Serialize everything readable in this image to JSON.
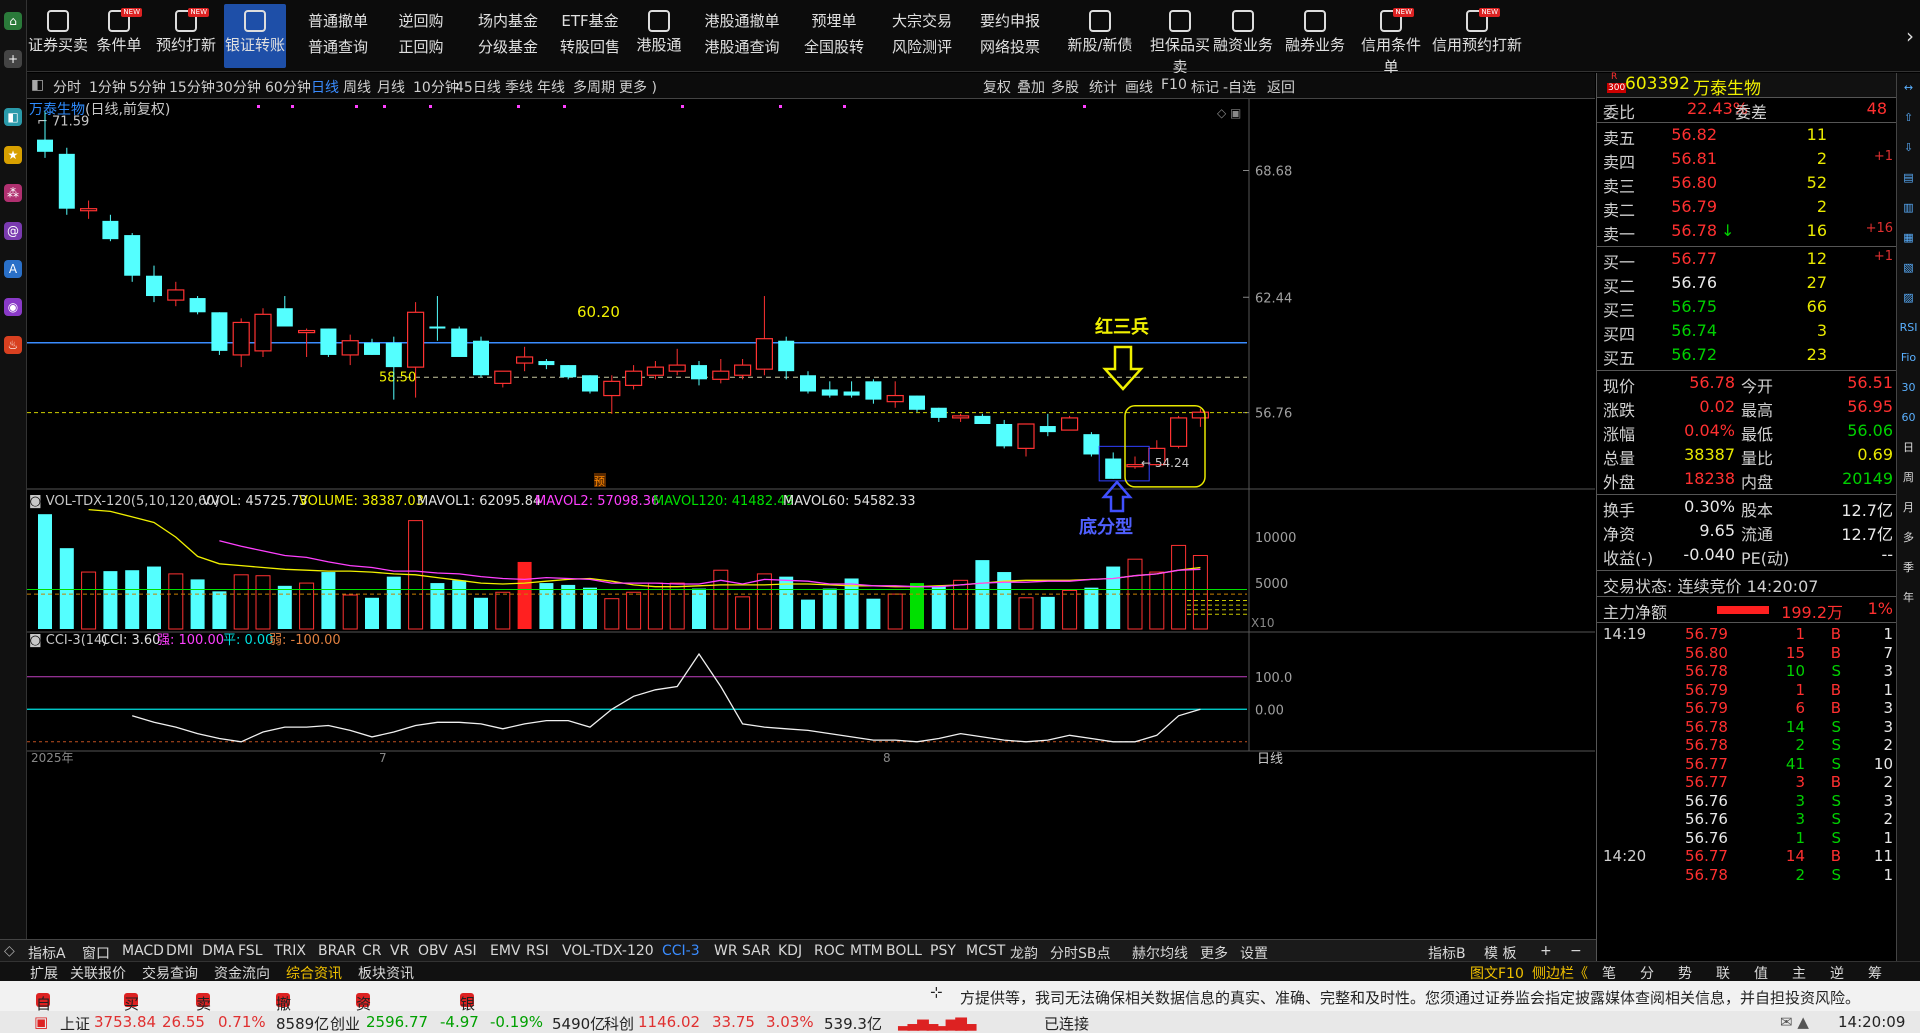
{
  "toolbar": {
    "items": [
      {
        "label": "证券买卖",
        "icon": "chart-up-icon"
      },
      {
        "label": "条件单",
        "icon": "condition-order-icon",
        "badge": "NEW"
      },
      {
        "label": "预约打新",
        "icon": "reserve-ipo-icon",
        "badge": "NEW"
      },
      {
        "label": "银证转账",
        "icon": "bank-transfer-icon",
        "active": true
      },
      {
        "label": "普通撤单",
        "label2": "普通查询"
      },
      {
        "label": "逆回购",
        "label2": "正回购"
      },
      {
        "label": "场内基金",
        "label2": "分级基金"
      },
      {
        "label": "ETF基金",
        "label2": "转股回售"
      },
      {
        "label": "港股通",
        "icon": "hk-icon"
      },
      {
        "label": "港股通撤单",
        "label2": "港股通查询"
      },
      {
        "label": "预埋单",
        "label2": "全国股转"
      },
      {
        "label": "大宗交易",
        "label2": "风险测评"
      },
      {
        "label": "要约申报",
        "label2": "网络投票"
      },
      {
        "label": "新股/新债",
        "icon": "new-stock-icon"
      },
      {
        "label": "担保品买卖",
        "icon": "collateral-icon"
      },
      {
        "label": "融资业务",
        "icon": "margin-finance-icon"
      },
      {
        "label": "融券业务",
        "icon": "short-selling-icon"
      },
      {
        "label": "信用条件单",
        "icon": "credit-condition-icon",
        "badge": "NEW"
      },
      {
        "label": "信用预约打新",
        "icon": "credit-ipo-icon",
        "badge": "NEW"
      }
    ]
  },
  "periods": [
    "分时",
    "1分钟",
    "5分钟",
    "15分钟",
    "30分钟",
    "60分钟",
    "日线",
    "周线",
    "月线",
    "10分钟",
    "45日线",
    "季线",
    "年线",
    "多周期",
    "更多 )"
  ],
  "period_selected": "日线",
  "period_right": [
    "复权",
    "叠加",
    "多股",
    "统计",
    "画线",
    "F10",
    "标记",
    "-自选",
    "返回"
  ],
  "main_chart": {
    "title": "万泰生物",
    "subtitle": "(日线,前复权)",
    "high_label": "71.59",
    "price_labels": [
      "68.68",
      "62.44",
      "56.76"
    ],
    "annot_6020": "60.20",
    "annot_5850": "58.50",
    "annot_5424": "54.24",
    "pre_mark": "预",
    "red_soldiers": "红三兵",
    "bottom_fractal": "底分型",
    "year_label": "2025年",
    "month7": "7",
    "month8": "8",
    "period_name": "日线"
  },
  "chart_data": {
    "type": "candlestick",
    "candles": [
      [
        70.2,
        71.59,
        69.3,
        69.6
      ],
      [
        69.5,
        69.8,
        66.5,
        66.8
      ],
      [
        66.7,
        67.2,
        66.3,
        66.8
      ],
      [
        66.2,
        66.5,
        65.2,
        65.3
      ],
      [
        65.5,
        65.6,
        63.2,
        63.5
      ],
      [
        63.5,
        64.0,
        62.2,
        62.5
      ],
      [
        62.3,
        63.2,
        62.0,
        62.8
      ],
      [
        62.4,
        62.5,
        61.6,
        61.7
      ],
      [
        61.7,
        61.7,
        59.6,
        59.8
      ],
      [
        59.6,
        61.4,
        59.0,
        61.2
      ],
      [
        59.8,
        61.9,
        59.5,
        61.6
      ],
      [
        61.9,
        62.5,
        61.0,
        61.0
      ],
      [
        60.7,
        60.9,
        59.5,
        60.8
      ],
      [
        60.9,
        60.9,
        59.5,
        59.6
      ],
      [
        59.6,
        60.6,
        59.1,
        60.3
      ],
      [
        60.2,
        60.4,
        59.6,
        59.6
      ],
      [
        60.2,
        60.5,
        57.4,
        59.0
      ],
      [
        59.0,
        62.2,
        57.5,
        61.7
      ],
      [
        61.0,
        62.5,
        60.3,
        60.9
      ],
      [
        60.9,
        61.0,
        59.5,
        59.5
      ],
      [
        60.3,
        60.5,
        58.5,
        58.6
      ],
      [
        58.2,
        58.8,
        58.0,
        58.8
      ],
      [
        59.2,
        60.0,
        58.8,
        59.5
      ],
      [
        59.3,
        59.4,
        58.9,
        59.1
      ],
      [
        59.1,
        59.1,
        58.4,
        58.5
      ],
      [
        58.6,
        58.6,
        57.7,
        57.8
      ],
      [
        57.6,
        58.6,
        56.7,
        58.3
      ],
      [
        58.1,
        59.1,
        57.9,
        58.8
      ],
      [
        58.6,
        59.3,
        58.4,
        59.0
      ],
      [
        58.8,
        59.9,
        58.6,
        59.1
      ],
      [
        59.1,
        59.3,
        58.1,
        58.4
      ],
      [
        58.4,
        59.4,
        58.2,
        58.8
      ],
      [
        58.6,
        59.4,
        58.4,
        59.1
      ],
      [
        58.9,
        62.5,
        58.6,
        60.4
      ],
      [
        60.3,
        60.5,
        58.4,
        58.8
      ],
      [
        58.6,
        58.8,
        57.7,
        57.8
      ],
      [
        57.9,
        58.3,
        57.5,
        57.6
      ],
      [
        57.8,
        58.3,
        57.5,
        57.6
      ],
      [
        58.3,
        58.4,
        57.2,
        57.4
      ],
      [
        57.3,
        58.3,
        57.0,
        57.6
      ],
      [
        57.6,
        57.6,
        56.8,
        56.9
      ],
      [
        57.0,
        57.0,
        56.3,
        56.5
      ],
      [
        56.5,
        56.7,
        56.3,
        56.6
      ],
      [
        56.6,
        56.7,
        56.2,
        56.2
      ],
      [
        56.2,
        56.4,
        55.0,
        55.1
      ],
      [
        55.0,
        56.2,
        54.6,
        56.2
      ],
      [
        56.1,
        56.7,
        55.6,
        55.8
      ],
      [
        55.9,
        56.6,
        56.0,
        56.5
      ],
      [
        55.7,
        55.8,
        54.6,
        54.7
      ],
      [
        54.5,
        54.8,
        53.5,
        53.5
      ],
      [
        54.1,
        54.6,
        54.0,
        54.2
      ],
      [
        54.2,
        55.4,
        54.2,
        55.0
      ],
      [
        55.1,
        56.6,
        55.0,
        56.5
      ],
      [
        56.5,
        56.95,
        56.06,
        56.78
      ]
    ],
    "volume": [
      12.5,
      8.8,
      6.2,
      6.3,
      6.4,
      6.8,
      6.0,
      5.4,
      4.1,
      5.9,
      5.8,
      4.7,
      5.0,
      6.2,
      3.7,
      3.4,
      5.7,
      11.8,
      5.0,
      5.3,
      3.4,
      4.0,
      7.3,
      5.0,
      4.8,
      4.5,
      3.3,
      4.0,
      5.0,
      5.0,
      4.4,
      6.4,
      3.5,
      6.0,
      5.7,
      3.2,
      4.4,
      5.5,
      3.3,
      3.8,
      5.0,
      4.7,
      5.3,
      7.5,
      6.2,
      3.4,
      3.5,
      4.2,
      4.5,
      6.8,
      7.6,
      6.2,
      9.1,
      8.0
    ],
    "ma_upper": [
      null,
      null,
      13.0,
      12.8,
      12.2,
      11.6,
      10.0,
      7.9,
      7.1,
      6.9,
      6.7,
      6.5,
      6.4,
      6.3,
      6.3,
      6.2,
      6.0,
      5.9,
      5.6,
      5.3,
      5.0,
      4.9,
      5.0,
      5.2,
      5.4,
      5.5,
      5.2,
      4.8,
      4.6,
      4.6,
      4.7,
      4.8,
      4.8,
      4.8,
      4.9,
      4.9,
      4.8,
      4.7,
      4.7,
      4.6,
      4.6,
      4.7,
      4.8,
      5.0,
      5.2,
      5.3,
      5.3,
      5.3,
      5.4,
      5.5,
      5.8,
      6.0,
      6.4,
      6.7
    ],
    "ma_pink": [
      null,
      null,
      null,
      null,
      null,
      null,
      null,
      null,
      9.6,
      9.0,
      8.5,
      8.0,
      7.8,
      7.3,
      6.9,
      6.7,
      6.3,
      6.3,
      6.1,
      6.0,
      5.7,
      5.5,
      5.4,
      5.6,
      5.5,
      5.4,
      5.0,
      5.0,
      5.0,
      4.9,
      4.9,
      5.3,
      4.9,
      5.4,
      5.3,
      5.2,
      4.9,
      4.9,
      4.7,
      4.7,
      4.6,
      4.6,
      4.8,
      5.0,
      5.1,
      5.1,
      5.2,
      5.2,
      5.4,
      5.5,
      5.8,
      6.0,
      6.4,
      6.5
    ],
    "cci": [
      -20,
      -40,
      -55,
      -75,
      -90,
      -100,
      -70,
      -55,
      -55,
      -50,
      -65,
      -85,
      -70,
      -50,
      -40,
      -40,
      -45,
      -60,
      -45,
      -35,
      -35,
      -55,
      0,
      40,
      60,
      70,
      170,
      70,
      -45,
      -55,
      -60,
      -65,
      -75,
      -85,
      -95,
      -95,
      -100,
      -90,
      -75,
      -85,
      -95,
      -100,
      -95,
      -80,
      -90,
      -100,
      -100,
      -80,
      -20,
      0
    ],
    "indicator": "VOL-TDX-120(5,10,120,60)",
    "VVOL": "45725.73",
    "VOLUME": "38387.03",
    "MAVOL1": "62095.84",
    "MAVOL2": "57098.36",
    "MAVOL120": "41482.49",
    "MAVOL60": "54582.33",
    "vol_ticks": [
      "10000",
      "5000"
    ],
    "vol_scale": "X10",
    "cci_name": "CCI-3(14)",
    "cci_val": "3.60",
    "cci_strong": "100.00",
    "cci_flat": "0.00",
    "cci_weak": "-100.00",
    "cci_ticks": [
      "100.0",
      "0.00"
    ]
  },
  "indicators_bar": [
    "指标A",
    "窗口",
    "MACD",
    "DMI",
    "DMA",
    "FSL",
    "TRIX",
    "BRAR",
    "CR",
    "VR",
    "OBV",
    "ASI",
    "EMV",
    "RSI",
    "VOL-TDX-120",
    "CCI-3",
    "WR",
    "SAR",
    "KDJ",
    "ROC",
    "MTM",
    "BOLL",
    "PSY",
    "MCST",
    "龙韵",
    "分时SB点",
    "赫尔均线",
    "更多",
    "设置"
  ],
  "indicators_right": [
    "指标B",
    "模 板"
  ],
  "ext_tabs": [
    "扩展",
    "关联报价",
    "交易查询",
    "资金流向",
    "综合资讯",
    "板块资讯"
  ],
  "ext_right": [
    "图文F10",
    "侧边栏《",
    "笔",
    "分",
    "势",
    "联",
    "值",
    "主",
    "逆",
    "筹"
  ],
  "quick": [
    {
      "icon": "self-select-icon",
      "label": "自选股"
    },
    {
      "icon": "buy-icon",
      "label": "买入"
    },
    {
      "icon": "sell-icon",
      "label": "卖出"
    },
    {
      "icon": "cancel-icon",
      "label": "撤单"
    },
    {
      "icon": "assets-icon",
      "label": "资产全景"
    },
    {
      "icon": "transfer-icon",
      "label": "银证转账"
    }
  ],
  "notice": "方提供等，我司无法确保相关数据信息的真实、准确、完整和及时性。您须通过证券监会指定披露媒体查阅相关信息，并自担投资风险。",
  "status": {
    "sh_name": "上证",
    "sh_val": "3753.84",
    "sh_chg": "26.55",
    "sh_pct": "0.71%",
    "sh_amt": "8589亿",
    "cy_name": "创业",
    "cy_val": "2596.77",
    "cy_chg": "-4.97",
    "cy_pct": "-0.19%",
    "cy_amt": "5490亿",
    "kc_name": "科创",
    "kc_val": "1146.02",
    "kc_chg": "33.75",
    "kc_pct": "3.03%",
    "kc_amt": "539.3亿",
    "conn": "已连接",
    "time": "14:20:09"
  },
  "quote": {
    "code": "603392",
    "name": "万泰生物",
    "tag": "R",
    "tag2": "300",
    "weibi_label": "委比",
    "weibi": "22.43%",
    "weicha_label": "委差",
    "weicha": "48",
    "asks": [
      {
        "l": "卖五",
        "p": "56.82",
        "q": "11",
        "c": ""
      },
      {
        "l": "卖四",
        "p": "56.81",
        "q": "2",
        "c": "+1"
      },
      {
        "l": "卖三",
        "p": "56.80",
        "q": "52",
        "c": ""
      },
      {
        "l": "卖二",
        "p": "56.79",
        "q": "2",
        "c": ""
      },
      {
        "l": "卖一",
        "p": "56.78",
        "q": "16",
        "c": "+16",
        "down": "↓"
      }
    ],
    "bids": [
      {
        "l": "买一",
        "p": "56.77",
        "q": "12",
        "c": "+1"
      },
      {
        "l": "买二",
        "p": "56.76",
        "q": "27",
        "c": ""
      },
      {
        "l": "买三",
        "p": "56.75",
        "q": "66",
        "c": ""
      },
      {
        "l": "买四",
        "p": "56.74",
        "q": "3",
        "c": ""
      },
      {
        "l": "买五",
        "p": "56.72",
        "q": "23",
        "c": ""
      }
    ],
    "stats": [
      {
        "l1": "现价",
        "v1": "56.78",
        "l2": "今开",
        "v2": "56.51"
      },
      {
        "l1": "涨跌",
        "v1": "0.02",
        "l2": "最高",
        "v2": "56.95"
      },
      {
        "l1": "涨幅",
        "v1": "0.04%",
        "l2": "最低",
        "v2": "56.06"
      },
      {
        "l1": "总量",
        "v1": "38387",
        "l2": "量比",
        "v2": "0.69"
      },
      {
        "l1": "外盘",
        "v1": "18238",
        "l2": "内盘",
        "v2": "20149"
      }
    ],
    "stats2": [
      {
        "l1": "换手",
        "v1": "0.30%",
        "l2": "股本",
        "v2": "12.7亿"
      },
      {
        "l1": "净资",
        "v1": "9.65",
        "l2": "流通",
        "v2": "12.7亿"
      },
      {
        "l1": "收益(-)",
        "v1": "-0.040",
        "l2": "PE(动)",
        "v2": "--"
      }
    ],
    "trade_state": "交易状态: 连续竞价 14:20:07",
    "main_flow_label": "主力净额",
    "main_flow": "199.2万",
    "main_flow_pct": "1%",
    "ticks": [
      {
        "t": "14:19",
        "p": "56.79",
        "q": "1",
        "s": "B",
        "n": "1"
      },
      {
        "t": "",
        "p": "56.80",
        "q": "15",
        "s": "B",
        "n": "7"
      },
      {
        "t": "",
        "p": "56.78",
        "q": "10",
        "s": "S",
        "n": "3"
      },
      {
        "t": "",
        "p": "56.79",
        "q": "1",
        "s": "B",
        "n": "1"
      },
      {
        "t": "",
        "p": "56.79",
        "q": "6",
        "s": "B",
        "n": "3"
      },
      {
        "t": "",
        "p": "56.78",
        "q": "14",
        "s": "S",
        "n": "3"
      },
      {
        "t": "",
        "p": "56.78",
        "q": "2",
        "s": "S",
        "n": "2"
      },
      {
        "t": "",
        "p": "56.77",
        "q": "41",
        "s": "S",
        "n": "10"
      },
      {
        "t": "",
        "p": "56.77",
        "q": "3",
        "s": "B",
        "n": "2"
      },
      {
        "t": "",
        "p": "56.76",
        "q": "3",
        "s": "S",
        "n": "3"
      },
      {
        "t": "",
        "p": "56.76",
        "q": "3",
        "s": "S",
        "n": "2"
      },
      {
        "t": "",
        "p": "56.76",
        "q": "1",
        "s": "S",
        "n": "1"
      },
      {
        "t": "14:20",
        "p": "56.77",
        "q": "14",
        "s": "B",
        "n": "11"
      },
      {
        "t": "",
        "p": "56.78",
        "q": "2",
        "s": "S",
        "n": "1"
      }
    ]
  },
  "rightbar": [
    "RSI",
    "Fio",
    "30",
    "60",
    "日",
    "周",
    "月",
    "多",
    "季",
    "年"
  ]
}
